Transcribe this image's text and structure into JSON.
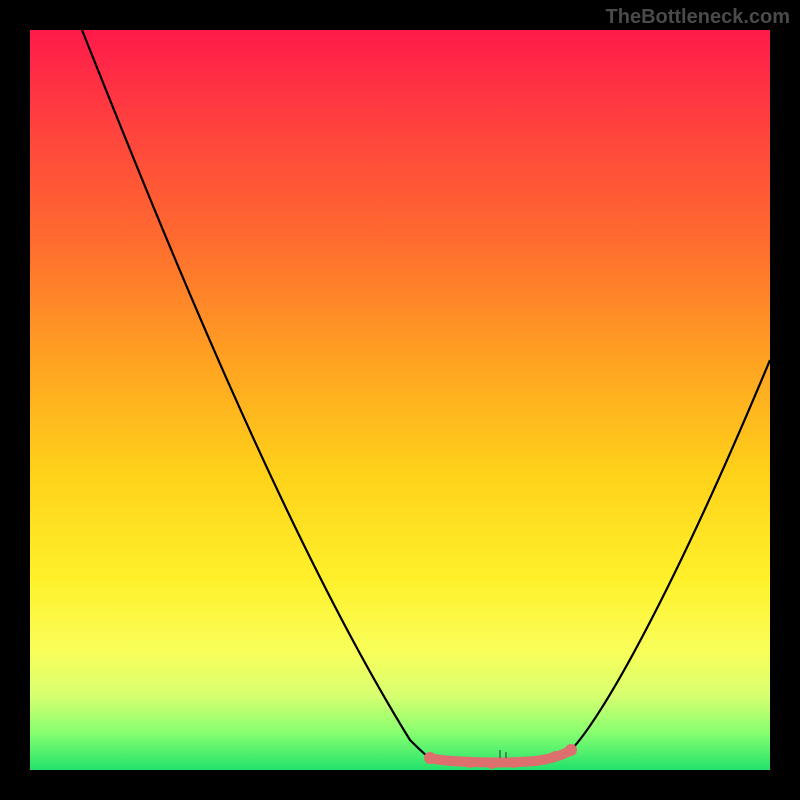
{
  "watermark": "TheBottleneck.com",
  "chart_data": {
    "type": "line",
    "title": "",
    "xlabel": "",
    "ylabel": "",
    "xlim": [
      0,
      100
    ],
    "ylim": [
      0,
      100
    ],
    "series": [
      {
        "name": "left-curve",
        "x": [
          7,
          12,
          18,
          24,
          30,
          36,
          42,
          47,
          51,
          54
        ],
        "y": [
          100,
          88,
          75,
          62,
          49,
          36,
          23,
          12,
          5,
          2
        ]
      },
      {
        "name": "valley-band",
        "x": [
          54,
          56,
          58,
          60,
          63,
          66,
          69,
          71,
          73
        ],
        "y": [
          2,
          1.5,
          1.2,
          1,
          1,
          1.2,
          1.5,
          2,
          3
        ]
      },
      {
        "name": "right-curve",
        "x": [
          73,
          77,
          82,
          88,
          94,
          100
        ],
        "y": [
          3,
          9,
          18,
          30,
          43,
          56
        ]
      }
    ],
    "markers": {
      "name": "valley-dots",
      "color": "#e06a6a",
      "x": [
        54,
        57,
        60,
        63,
        66,
        69,
        72,
        73
      ],
      "y": [
        2,
        1.5,
        1,
        1,
        1.2,
        1.5,
        2.5,
        3
      ]
    },
    "gradient_stops": [
      {
        "y": 0,
        "color": "#ff1a4a"
      },
      {
        "y": 28,
        "color": "#ff6a2f"
      },
      {
        "y": 60,
        "color": "#ffd21a"
      },
      {
        "y": 84,
        "color": "#f9ff5a"
      },
      {
        "y": 95,
        "color": "#86ff70"
      },
      {
        "y": 100,
        "color": "#22e26b"
      }
    ]
  }
}
